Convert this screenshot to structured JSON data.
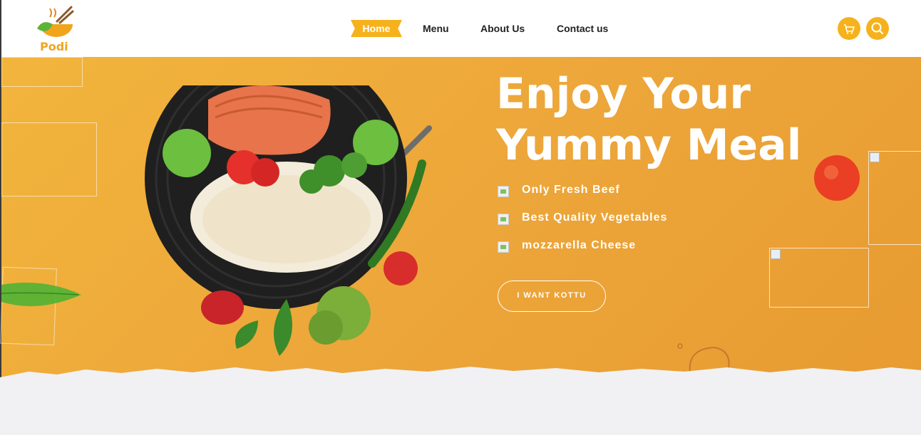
{
  "brand": {
    "name": "Podi",
    "logo_icon": "bowl-chopsticks-logo"
  },
  "nav": {
    "items": [
      {
        "label": "Home",
        "active": true
      },
      {
        "label": "Menu",
        "active": false
      },
      {
        "label": "About Us",
        "active": false
      },
      {
        "label": "Contact us",
        "active": false
      }
    ]
  },
  "header_actions": {
    "cart_icon": "cart-icon",
    "search_icon": "search-icon"
  },
  "hero": {
    "title": "Enjoy Your Yummy Meal",
    "features": [
      {
        "label": "Only Fresh Beef"
      },
      {
        "label": "Best Quality Vegetables"
      },
      {
        "label": "mozzarella Cheese"
      }
    ],
    "cta_label": "I WANT KOTTU"
  },
  "colors": {
    "accent": "#f6b21c",
    "hero_bg_start": "#f2b53c",
    "hero_bg_end": "#e79a30",
    "text_light": "#ffffff",
    "nav_text": "#222222"
  }
}
